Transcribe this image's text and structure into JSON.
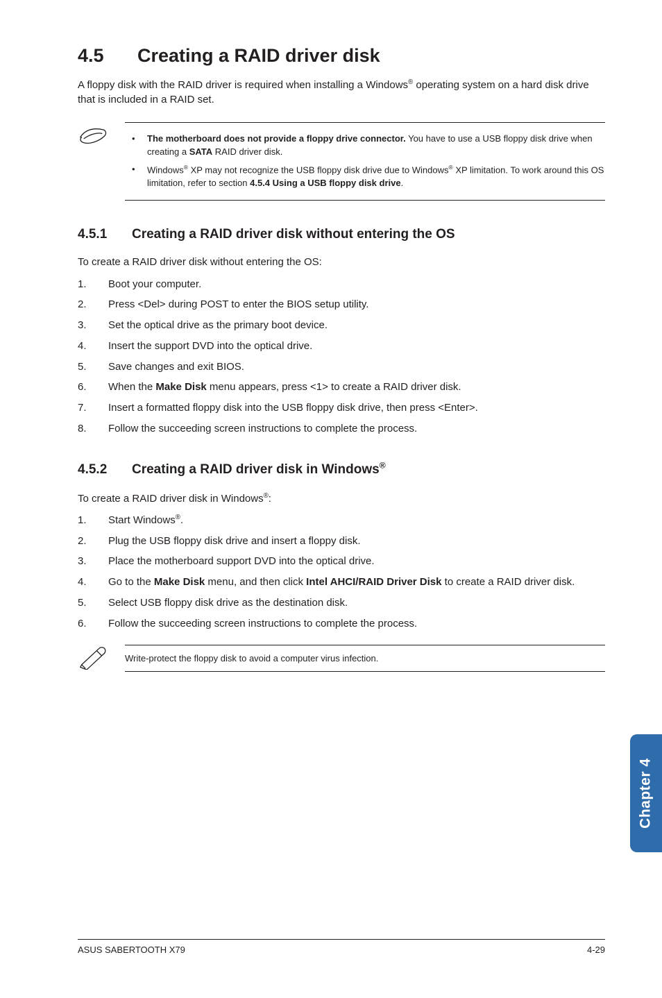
{
  "title": {
    "num": "4.5",
    "text": "Creating a RAID driver disk"
  },
  "intro": {
    "pre": "A floppy disk with the RAID driver is required when installing a Windows",
    "sup": "®",
    "post": " operating system on a hard disk drive that is included in a RAID set."
  },
  "callout": [
    {
      "b1": "The motherboard does not provide a floppy drive connector.",
      "t1": " You have to use a USB floppy disk drive when creating a ",
      "b2": "SATA",
      "t2": " RAID driver disk."
    },
    {
      "t1": "Windows",
      "sup1": "®",
      "t2": " XP may not recognize the USB floppy disk drive due to Windows",
      "sup2": "®",
      "t3": " XP limitation. To work around this OS limitation, refer to section ",
      "b1": "4.5.4 Using a USB floppy disk drive",
      "t4": "."
    }
  ],
  "sub1": {
    "num": "4.5.1",
    "title": "Creating a RAID driver disk without entering the OS",
    "lead": "To create a RAID driver disk without entering the OS:",
    "steps": [
      "Boot your computer.",
      "Press <Del> during POST to enter the BIOS setup utility.",
      "Set the optical drive as the primary boot device.",
      "Insert the support DVD into the optical drive.",
      "Save changes and exit BIOS.",
      {
        "pre": "When the ",
        "b": "Make Disk",
        "post": " menu appears, press <1> to create a RAID driver disk."
      },
      "Insert a formatted floppy disk into the USB floppy disk drive, then press <Enter>.",
      "Follow the succeeding screen instructions to complete the process."
    ]
  },
  "sub2": {
    "num": "4.5.2",
    "title_pre": "Creating a RAID driver disk in Windows",
    "title_sup": "®",
    "lead_pre": "To create a RAID driver disk in Windows",
    "lead_sup": "®",
    "lead_post": ":",
    "steps": [
      {
        "pre": "Start Windows",
        "sup": "®",
        "post": "."
      },
      "Plug the USB floppy disk drive and insert a floppy disk.",
      "Place the motherboard support DVD into the optical drive.",
      {
        "pre": "Go to the ",
        "b1": "Make Disk",
        "mid": " menu, and then click ",
        "b2": "Intel AHCI/RAID Driver Disk",
        "post": " to create a RAID driver disk."
      },
      "Select USB floppy disk drive as the destination disk.",
      "Follow the succeeding screen instructions to complete the process."
    ]
  },
  "note": "Write-protect the floppy disk to avoid a computer virus infection.",
  "sidetab": "Chapter 4",
  "footer": {
    "left": "ASUS SABERTOOTH X79",
    "right": "4-29"
  }
}
